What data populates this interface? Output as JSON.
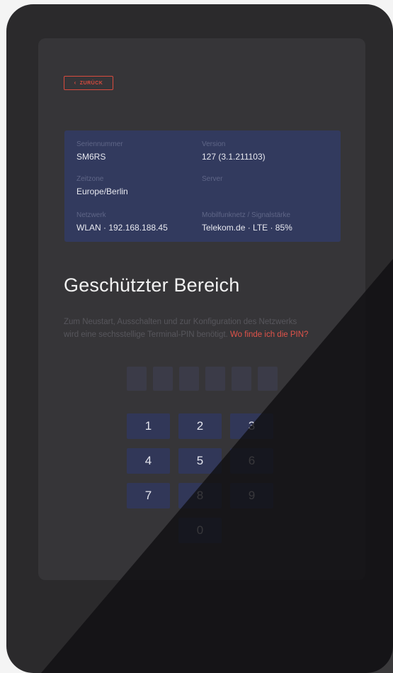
{
  "back_button": {
    "label": "ZURÜCK",
    "icon": "chevron-left-icon"
  },
  "info": {
    "serial": {
      "label": "Seriennummer",
      "value": "SM6RS"
    },
    "version": {
      "label": "Version",
      "value": "127 (3.1.211103)"
    },
    "timezone": {
      "label": "Zeitzone",
      "value": "Europe/Berlin"
    },
    "server": {
      "label": "Server",
      "value": ""
    },
    "network": {
      "label": "Netzwerk",
      "value": "WLAN · 192.168.188.45"
    },
    "mobile": {
      "label": "Mobilfunknetz / Signalstärke",
      "value": "Telekom.de · LTE · 85%"
    }
  },
  "title": "Geschützter Bereich",
  "description": {
    "line1": "Zum Neustart, Ausschalten und zur Konfiguration des Netzwerks",
    "line2": "wird eine sechsstellige Terminal-PIN benötigt.",
    "link": "Wo finde ich die PIN?"
  },
  "pin_length": 6,
  "keypad": {
    "keys": [
      "1",
      "2",
      "3",
      "4",
      "5",
      "6",
      "7",
      "8",
      "9",
      "0"
    ]
  },
  "colors": {
    "accent": "#d94b3e",
    "card": "#323a5e",
    "key": "#313758",
    "screen": "#363538",
    "device": "#2b2a2c"
  }
}
